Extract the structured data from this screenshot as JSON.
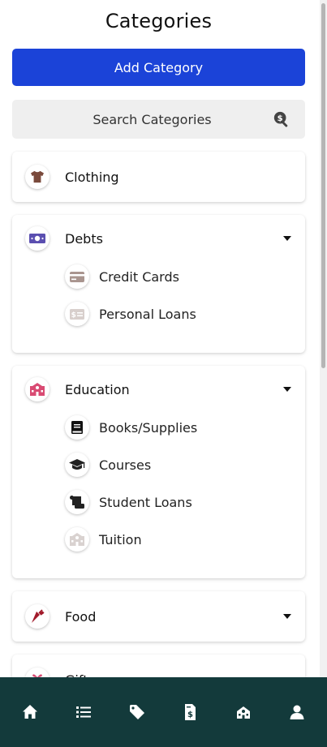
{
  "header": {
    "title": "Categories"
  },
  "actions": {
    "add_label": "Add Category"
  },
  "search": {
    "placeholder": "Search Categories"
  },
  "categories": [
    {
      "label": "Clothing",
      "icon": "shirt-icon",
      "color": "#7a4a3c"
    },
    {
      "label": "Debts",
      "icon": "money-bill-icon",
      "color": "#5b4fb0",
      "children": [
        {
          "label": "Credit Cards",
          "icon": "credit-card-icon"
        },
        {
          "label": "Personal Loans",
          "icon": "money-check-icon"
        }
      ]
    },
    {
      "label": "Education",
      "icon": "school-icon",
      "color": "#d94b73",
      "children": [
        {
          "label": "Books/Supplies",
          "icon": "book-icon"
        },
        {
          "label": "Courses",
          "icon": "graduation-cap-icon"
        },
        {
          "label": "Student Loans",
          "icon": "scroll-icon"
        },
        {
          "label": "Tuition",
          "icon": "school-building-icon"
        }
      ]
    },
    {
      "label": "Food",
      "icon": "carrot-icon",
      "color": "#a1192a"
    },
    {
      "label": "Gifts",
      "icon": "gift-icon",
      "color": "#d94b73"
    }
  ],
  "nav": [
    {
      "name": "home",
      "icon": "home-icon"
    },
    {
      "name": "list",
      "icon": "list-icon"
    },
    {
      "name": "tags",
      "icon": "tag-icon"
    },
    {
      "name": "invoice",
      "icon": "file-invoice-dollar-icon"
    },
    {
      "name": "savings",
      "icon": "piggy-bank-icon"
    },
    {
      "name": "profile",
      "icon": "user-icon"
    }
  ],
  "colors": {
    "primary": "#1b43d8",
    "nav_bg": "#133a3b"
  }
}
